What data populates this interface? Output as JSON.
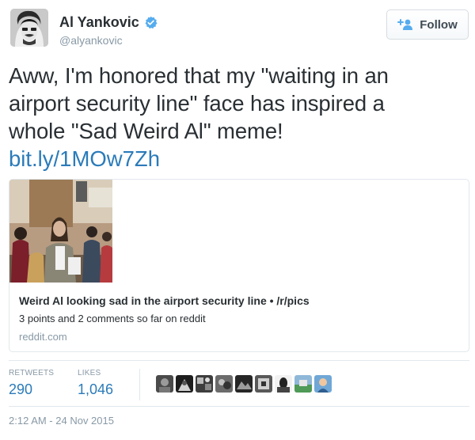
{
  "author": {
    "name": "Al Yankovic",
    "handle": "@alyankovic",
    "verified": true
  },
  "follow_button": {
    "label": "Follow",
    "icon": "add-user-icon"
  },
  "tweet": {
    "text_lines": [
      "Aww, I'm honored that my \"waiting in an",
      "airport security line\" face has inspired a",
      "whole \"Sad Weird Al\" meme!"
    ],
    "link": "bit.ly/1MOw7Zh"
  },
  "card": {
    "title": "Weird Al looking sad in the airport security line • /r/pics",
    "description": "3 points and 2 comments so far on reddit",
    "domain": "reddit.com"
  },
  "stats": {
    "retweets_label": "RETWEETS",
    "retweets": "290",
    "likes_label": "LIKES",
    "likes": "1,046"
  },
  "likers_count_shown": 9,
  "timestamp": "2:12 AM - 24 Nov 2015",
  "colors": {
    "link": "#2b7bb9",
    "verified": "#55acee",
    "muted": "#8899a6",
    "text": "#292f33",
    "border": "#e1e8ed"
  }
}
